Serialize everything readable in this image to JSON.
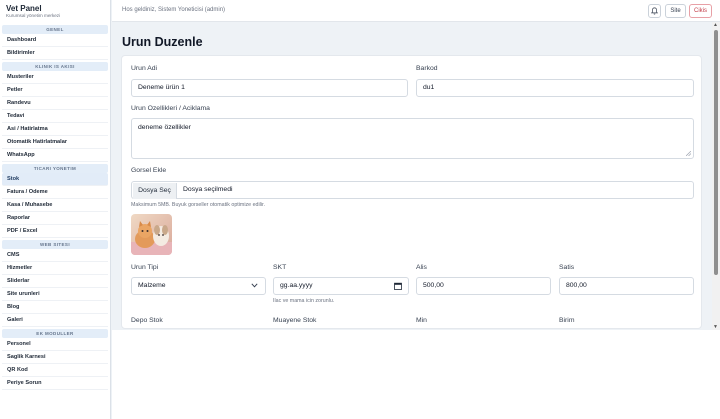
{
  "brand": {
    "title": "Vet Panel",
    "subtitle": "Kurumsal yönetim merkezi"
  },
  "sidebar": {
    "groups": [
      {
        "title": "GENEL",
        "items": [
          "Dashboard",
          "Bildirimler"
        ]
      },
      {
        "title": "KLINIK IS AKISI",
        "items": [
          "Musteriler",
          "Petler",
          "Randevu",
          "Tedavi",
          "Asi / Hatirlatma",
          "Otomatik Hatirlatmalar",
          "WhatsApp"
        ]
      },
      {
        "title": "TICARI YONETIM",
        "items": [
          "Stok",
          "Fatura / Odeme",
          "Kasa / Muhasebe",
          "Raporlar",
          "PDF / Excel"
        ]
      },
      {
        "title": "WEB SITESI",
        "items": [
          "CMS",
          "Hizmetler",
          "Sliderlar",
          "Site urunleri",
          "Blog",
          "Galeri"
        ]
      },
      {
        "title": "EK MODULLER",
        "items": [
          "Personel",
          "Saglik Karnesi",
          "QR Kod",
          "Periye Sorun"
        ]
      }
    ],
    "active_item": "Stok"
  },
  "topbar": {
    "welcome": "Hos geldiniz, Sistem Yoneticisi (admin)",
    "bell_icon": "bell-icon",
    "site_label": "Site",
    "logout_label": "Cikis"
  },
  "page": {
    "title": "Urun Duzenle"
  },
  "form": {
    "name_label": "Urun Adi",
    "name_value": "Deneme ürün 1",
    "barcode_label": "Barkod",
    "barcode_value": "du1",
    "desc_label": "Urun Ozellikleri / Aciklama",
    "desc_value": "deneme özellikler",
    "image_label": "Gorsel Ekle",
    "file_button": "Dosya Seç",
    "file_status": "Dosya seçilmedi",
    "image_hint": "Maksimum 5MB. Buyuk gorseller otomatik optimize edilir.",
    "type_label": "Urun Tipi",
    "type_value": "Malzeme",
    "skt_label": "SKT",
    "skt_placeholder": "gg.aa.yyyy",
    "skt_hint": "Ilac ve mama icin zorunlu.",
    "buy_label": "Alis",
    "buy_value": "500,00",
    "sell_label": "Satis",
    "sell_value": "800,00",
    "depot_label": "Depo Stok",
    "exam_label": "Muayene Stok",
    "min_label": "Min",
    "unit_label": "Birim"
  },
  "colors": {
    "accent": "#2563eb",
    "active_bg": "#e2ecf8",
    "danger": "#c23c48"
  }
}
